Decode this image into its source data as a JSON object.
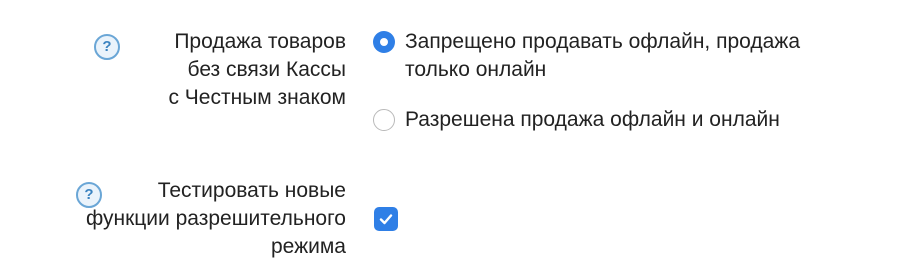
{
  "settings": [
    {
      "help_icon_glyph": "?",
      "label_lines": [
        "Продажа товаров",
        "без связи Кассы",
        "с Честным знаком"
      ],
      "options": [
        {
          "label_lines": [
            "Запрещено продавать офлайн, продажа",
            "только онлайн"
          ],
          "selected": true
        },
        {
          "label_lines": [
            "Разрешена продажа офлайн и онлайн"
          ],
          "selected": false
        }
      ]
    },
    {
      "help_icon_glyph": "?",
      "label_lines": [
        "Тестировать новые",
        "функции разрешительного",
        "режима"
      ],
      "checkbox_checked": true
    }
  ],
  "icons": {
    "help": "question-circle-icon",
    "checkmark": "checkmark-icon"
  },
  "colors": {
    "accent": "#2f7fe6",
    "help_icon_border": "#6aa6d6",
    "help_icon_text": "#3b83c0",
    "text": "#222222"
  }
}
